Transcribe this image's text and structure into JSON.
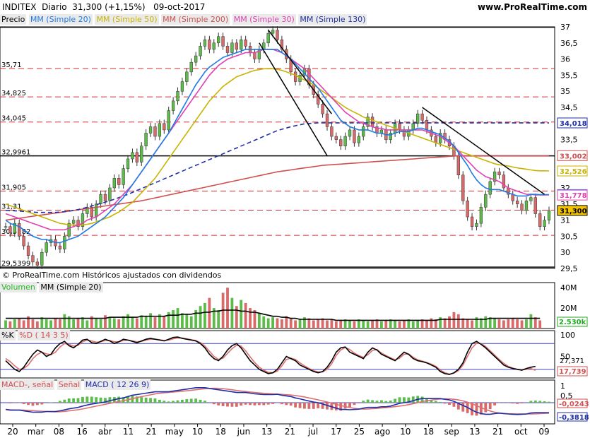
{
  "header": {
    "ticker": "INDITEX",
    "period": "Diario",
    "last": "31,300 (+1,15%)",
    "date": "09-oct-2017",
    "site": "www.ProRealTime.com"
  },
  "legend": [
    {
      "label": "Precio",
      "color": "#000000"
    },
    {
      "label": "MM (Simple 20)",
      "color": "#1e7be6"
    },
    {
      "label": "MM (Simple 50)",
      "color": "#c8b400"
    },
    {
      "label": "MM (Simple 200)",
      "color": "#d05050"
    },
    {
      "label": "MM (Simple 30)",
      "color": "#e040b0"
    },
    {
      "label": "MM (Simple 130)",
      "color": "#1f2fa8"
    }
  ],
  "copyright": "© ProRealTime.com Históricos ajustados con dividendos",
  "volume_label": {
    "vol": "Volumen",
    "mm": "MM (Simple 20)"
  },
  "stoch_label": {
    "k": "%K",
    "d": "%D ( 14 3 5)"
  },
  "macd_label": {
    "macd": "MACD-, señal",
    "senal": "Señal",
    "params": "MACD ( 12 26 9)"
  },
  "price_axis_ticks": [
    "37",
    "36,5",
    "36",
    "35,5",
    "35",
    "34,5",
    "34",
    "33,5",
    "33",
    "32,5",
    "32",
    "31,5",
    "31",
    "30,5",
    "30",
    "29,5"
  ],
  "left_levels": [
    "35,71",
    "34,825",
    "34,045",
    "32,9961",
    "31,905",
    "31,31",
    "30,5282",
    "29,5399"
  ],
  "right_badges": [
    {
      "text": "34,018",
      "color": "#1f2fa8",
      "bg": "#ffffff"
    },
    {
      "text": "33,002",
      "color": "#d05050",
      "bg": "#ffffff"
    },
    {
      "text": "32,526",
      "color": "#c8b400",
      "bg": "#ffffff"
    },
    {
      "text": "31,794",
      "color": "#1e7be6",
      "bg": "#ffffff"
    },
    {
      "text": "31,778",
      "color": "#e040b0",
      "bg": "#ffffff"
    },
    {
      "text": "31,300",
      "color": "#000000",
      "bg": "#f5c400"
    }
  ],
  "volume_axis": [
    "40M",
    "20M",
    "2.530k"
  ],
  "stoch_axis": [
    "100",
    "50",
    "27,371",
    "17,739"
  ],
  "macd_axis": [
    "1",
    "0,5",
    "-0,0243",
    "-0,3818"
  ],
  "x_labels": [
    "20",
    "mar",
    "08",
    "16",
    "abr",
    "11",
    "21",
    "may",
    "10",
    "18",
    "jun",
    "13",
    "21",
    "jul",
    "17",
    "25",
    "ago",
    "10",
    "18",
    "sep",
    "13",
    "21",
    "oct",
    "09"
  ],
  "chart_data": {
    "type": "candlestick",
    "title": "INDITEX Diario",
    "ylim": [
      29.5,
      37
    ],
    "levels_solid": [
      36.99,
      32.9961,
      29.5399
    ],
    "levels_dashed": [
      35.71,
      34.825,
      34.045,
      31.905,
      31.31,
      30.5282
    ],
    "close_series": [
      30.8,
      30.6,
      30.9,
      30.5,
      30.2,
      29.9,
      29.7,
      29.6,
      30.0,
      30.3,
      30.4,
      30.2,
      30.1,
      30.5,
      30.9,
      31.0,
      30.8,
      31.2,
      31.4,
      31.1,
      31.5,
      31.8,
      31.6,
      32.0,
      32.3,
      32.1,
      32.6,
      32.9,
      33.1,
      32.8,
      33.3,
      33.7,
      33.9,
      33.6,
      34.0,
      33.8,
      34.4,
      34.7,
      35.0,
      35.3,
      35.6,
      35.9,
      36.1,
      36.4,
      36.6,
      36.3,
      36.5,
      36.7,
      36.4,
      36.2,
      36.5,
      36.3,
      36.6,
      36.4,
      36.2,
      36.0,
      36.3,
      36.5,
      36.8,
      36.9,
      36.6,
      36.3,
      36.0,
      35.6,
      35.3,
      35.5,
      35.7,
      35.2,
      34.9,
      34.6,
      34.3,
      33.9,
      33.6,
      33.5,
      33.3,
      33.6,
      33.8,
      33.4,
      33.6,
      33.9,
      34.2,
      33.9,
      33.7,
      33.8,
      33.5,
      33.7,
      34.0,
      33.8,
      33.6,
      33.8,
      34.0,
      34.3,
      34.1,
      33.8,
      33.6,
      33.4,
      33.7,
      33.5,
      33.3,
      33.0,
      32.4,
      31.6,
      31.1,
      30.8,
      30.9,
      31.4,
      31.8,
      32.2,
      32.5,
      32.4,
      32.0,
      31.8,
      31.6,
      31.5,
      31.3,
      31.6,
      31.7,
      31.2,
      30.8,
      31.0,
      31.3
    ],
    "ma20": [
      31.0,
      30.9,
      30.85,
      30.8,
      30.7,
      30.6,
      30.5,
      30.45,
      30.4,
      30.4,
      30.35,
      30.3,
      30.3,
      30.35,
      30.4,
      30.45,
      30.5,
      30.6,
      30.7,
      30.8,
      30.9,
      31.0,
      31.1,
      31.25,
      31.4,
      31.55,
      31.7,
      31.9,
      32.1,
      32.3,
      32.5,
      32.7,
      32.9,
      33.1,
      33.3,
      33.5,
      33.7,
      33.95,
      34.2,
      34.45,
      34.7,
      34.95,
      35.2,
      35.4,
      35.6,
      35.75,
      35.85,
      35.95,
      36.05,
      36.1,
      36.15,
      36.2,
      36.25,
      36.3,
      36.3,
      36.3,
      36.3,
      36.3,
      36.3,
      36.3,
      36.3,
      36.2,
      36.1,
      36.0,
      35.85,
      35.7,
      35.55,
      35.4,
      35.25,
      35.1,
      34.9,
      34.7,
      34.5,
      34.3,
      34.1,
      34.0,
      33.9,
      33.85,
      33.8,
      33.8,
      33.8,
      33.75,
      33.7,
      33.7,
      33.65,
      33.65,
      33.7,
      33.75,
      33.75,
      33.75,
      33.8,
      33.85,
      33.85,
      33.8,
      33.75,
      33.7,
      33.65,
      33.55,
      33.45,
      33.3,
      33.1,
      32.9,
      32.7,
      32.45,
      32.25,
      32.1,
      32.0,
      31.95,
      31.95,
      31.95,
      31.9,
      31.85,
      31.8,
      31.75,
      31.75,
      31.75,
      31.8,
      31.8,
      31.79,
      31.79,
      31.79
    ],
    "ma30": [
      31.2,
      31.15,
      31.1,
      31.05,
      31.0,
      30.95,
      30.9,
      30.85,
      30.8,
      30.75,
      30.7,
      30.7,
      30.7,
      30.7,
      30.75,
      30.8,
      30.85,
      30.9,
      31.0,
      31.05,
      31.1,
      31.2,
      31.3,
      31.4,
      31.5,
      31.65,
      31.8,
      31.95,
      32.1,
      32.3,
      32.5,
      32.7,
      32.9,
      33.1,
      33.3,
      33.5,
      33.7,
      33.9,
      34.1,
      34.3,
      34.5,
      34.7,
      34.9,
      35.1,
      35.3,
      35.5,
      35.65,
      35.8,
      35.9,
      36.0,
      36.05,
      36.1,
      36.15,
      36.2,
      36.2,
      36.2,
      36.25,
      36.3,
      36.3,
      36.3,
      36.25,
      36.2,
      36.1,
      36.0,
      35.9,
      35.8,
      35.7,
      35.55,
      35.4,
      35.25,
      35.1,
      34.95,
      34.8,
      34.65,
      34.5,
      34.35,
      34.25,
      34.15,
      34.05,
      34.0,
      33.95,
      33.9,
      33.85,
      33.85,
      33.8,
      33.8,
      33.8,
      33.8,
      33.8,
      33.8,
      33.8,
      33.8,
      33.8,
      33.75,
      33.7,
      33.65,
      33.6,
      33.5,
      33.4,
      33.3,
      33.15,
      33.0,
      32.85,
      32.7,
      32.55,
      32.45,
      32.35,
      32.3,
      32.25,
      32.2,
      32.1,
      32.0,
      31.95,
      31.9,
      31.85,
      31.8,
      31.8,
      31.78,
      31.78,
      31.78,
      31.78
    ],
    "ma50": [
      31.5,
      31.45,
      31.4,
      31.35,
      31.3,
      31.25,
      31.2,
      31.15,
      31.1,
      31.05,
      31.0,
      30.95,
      30.9,
      30.88,
      30.85,
      30.85,
      30.85,
      30.85,
      30.87,
      30.9,
      30.95,
      31.0,
      31.05,
      31.1,
      31.18,
      31.25,
      31.35,
      31.45,
      31.55,
      31.7,
      31.85,
      32.0,
      32.15,
      32.3,
      32.5,
      32.7,
      32.9,
      33.1,
      33.3,
      33.5,
      33.7,
      33.9,
      34.1,
      34.3,
      34.5,
      34.7,
      34.85,
      35.0,
      35.15,
      35.25,
      35.35,
      35.45,
      35.5,
      35.55,
      35.6,
      35.65,
      35.67,
      35.7,
      35.7,
      35.7,
      35.68,
      35.65,
      35.6,
      35.55,
      35.5,
      35.42,
      35.35,
      35.28,
      35.2,
      35.1,
      35.0,
      34.9,
      34.8,
      34.7,
      34.6,
      34.5,
      34.42,
      34.35,
      34.28,
      34.2,
      34.15,
      34.1,
      34.05,
      34.0,
      33.95,
      33.9,
      33.85,
      33.8,
      33.75,
      33.7,
      33.65,
      33.6,
      33.55,
      33.5,
      33.45,
      33.4,
      33.35,
      33.3,
      33.25,
      33.2,
      33.15,
      33.1,
      33.05,
      33.0,
      32.95,
      32.9,
      32.85,
      32.8,
      32.75,
      32.72,
      32.7,
      32.68,
      32.65,
      32.62,
      32.6,
      32.58,
      32.56,
      32.54,
      32.53,
      32.53,
      32.526
    ],
    "ma130": [
      31.3,
      31.3,
      31.29,
      31.28,
      31.27,
      31.26,
      31.25,
      31.24,
      31.24,
      31.24,
      31.24,
      31.24,
      31.25,
      31.26,
      31.28,
      31.3,
      31.33,
      31.36,
      31.4,
      31.44,
      31.48,
      31.52,
      31.56,
      31.6,
      31.65,
      31.7,
      31.75,
      31.8,
      31.86,
      31.92,
      31.98,
      32.04,
      32.1,
      32.16,
      32.22,
      32.28,
      32.34,
      32.4,
      32.46,
      32.52,
      32.58,
      32.64,
      32.7,
      32.76,
      32.82,
      32.88,
      32.94,
      33.0,
      33.06,
      33.12,
      33.18,
      33.24,
      33.3,
      33.36,
      33.42,
      33.48,
      33.54,
      33.6,
      33.66,
      33.72,
      33.78,
      33.82,
      33.86,
      33.9,
      33.93,
      33.96,
      33.99,
      34.0,
      34.01,
      34.02,
      34.02,
      34.02,
      34.02,
      34.02,
      34.02,
      34.02,
      34.02,
      34.02,
      34.02,
      34.02,
      34.02,
      34.02,
      34.02,
      34.02,
      34.02,
      34.02,
      34.02,
      34.02,
      34.02,
      34.02,
      34.02,
      34.02,
      34.02,
      34.02,
      34.02,
      34.02,
      34.02,
      34.02,
      34.02,
      34.02,
      34.02,
      34.02,
      34.02,
      34.02,
      34.02,
      34.02,
      34.02,
      34.02,
      34.02,
      34.02,
      34.02,
      34.02,
      34.02,
      34.02,
      34.02,
      34.02,
      34.02,
      34.02,
      34.02,
      34.02,
      34.018
    ],
    "ma200": [
      31.0,
      31.02,
      31.04,
      31.06,
      31.08,
      31.1,
      31.12,
      31.14,
      31.16,
      31.18,
      31.2,
      31.22,
      31.24,
      31.26,
      31.28,
      31.3,
      31.32,
      31.34,
      31.36,
      31.38,
      31.4,
      31.42,
      31.44,
      31.46,
      31.48,
      31.5,
      31.52,
      31.54,
      31.56,
      31.58,
      31.6,
      31.63,
      31.66,
      31.69,
      31.72,
      31.75,
      31.78,
      31.81,
      31.84,
      31.87,
      31.9,
      31.93,
      31.96,
      31.99,
      32.02,
      32.05,
      32.08,
      32.11,
      32.14,
      32.17,
      32.2,
      32.23,
      32.26,
      32.29,
      32.32,
      32.35,
      32.38,
      32.41,
      32.44,
      32.47,
      32.5,
      32.52,
      32.54,
      32.56,
      32.58,
      32.6,
      32.62,
      32.64,
      32.66,
      32.68,
      32.7,
      32.71,
      32.72,
      32.73,
      32.74,
      32.75,
      32.76,
      32.77,
      32.78,
      32.79,
      32.8,
      32.81,
      32.82,
      32.83,
      32.84,
      32.85,
      32.86,
      32.87,
      32.88,
      32.89,
      32.9,
      32.91,
      32.92,
      32.93,
      32.94,
      32.95,
      32.96,
      32.97,
      32.98,
      32.99,
      33.0,
      33.0,
      33.0,
      33.0,
      33.0,
      33.0,
      33.0,
      33.0,
      33.0,
      33.0,
      33.0,
      33.0,
      33.0,
      33.0,
      33.0,
      33.0,
      33.0,
      33.0,
      33.0,
      33.0,
      33.002
    ],
    "volume": [
      8,
      7,
      9,
      10,
      8,
      12,
      9,
      7,
      11,
      9,
      8,
      10,
      9,
      14,
      12,
      9,
      10,
      11,
      8,
      12,
      10,
      9,
      13,
      11,
      10,
      9,
      12,
      14,
      11,
      10,
      13,
      12,
      15,
      11,
      14,
      12,
      16,
      18,
      20,
      15,
      14,
      12,
      18,
      22,
      25,
      30,
      20,
      18,
      35,
      40,
      30,
      22,
      28,
      25,
      20,
      18,
      15,
      12,
      10,
      11,
      10,
      9,
      12,
      10,
      8,
      9,
      11,
      10,
      8,
      9,
      10,
      8,
      9,
      7,
      8,
      9,
      8,
      7,
      9,
      8,
      7,
      8,
      9,
      7,
      8,
      9,
      8,
      7,
      8,
      9,
      7,
      8,
      9,
      8,
      10,
      9,
      11,
      10,
      12,
      16,
      14,
      10,
      9,
      8,
      11,
      10,
      12,
      11,
      10,
      9,
      8,
      9,
      10,
      9,
      8,
      9,
      14,
      11,
      8
    ],
    "volume_ma20": [
      10,
      10,
      10,
      10,
      10,
      10,
      10,
      10,
      10,
      10,
      10,
      10,
      10,
      10,
      10,
      10,
      10,
      10,
      10,
      10,
      10,
      10,
      10,
      11,
      11,
      11,
      11,
      11,
      11,
      11,
      12,
      12,
      12,
      12,
      12,
      12,
      13,
      13,
      13,
      14,
      14,
      14,
      15,
      15,
      16,
      16,
      17,
      17,
      18,
      18,
      18,
      18,
      17,
      17,
      16,
      16,
      15,
      14,
      13,
      12,
      12,
      11,
      11,
      10,
      10,
      9,
      9,
      9,
      9,
      9,
      9,
      9,
      9,
      8,
      8,
      8,
      8,
      8,
      8,
      8,
      8,
      8,
      8,
      8,
      8,
      8,
      8,
      8,
      8,
      8,
      8,
      8,
      8,
      8,
      8,
      8,
      9,
      9,
      9,
      9,
      9,
      9,
      9,
      9,
      9,
      9,
      9,
      10,
      10,
      10,
      10,
      10,
      10,
      10,
      10,
      10,
      10,
      10,
      10
    ],
    "stoch_k": [
      40,
      30,
      20,
      15,
      25,
      40,
      55,
      65,
      60,
      50,
      55,
      70,
      80,
      85,
      75,
      70,
      78,
      88,
      90,
      82,
      80,
      85,
      90,
      86,
      80,
      84,
      90,
      88,
      85,
      82,
      86,
      90,
      92,
      90,
      88,
      86,
      90,
      94,
      95,
      92,
      90,
      88,
      86,
      80,
      70,
      55,
      45,
      40,
      50,
      65,
      75,
      80,
      70,
      55,
      40,
      30,
      20,
      15,
      10,
      12,
      20,
      35,
      50,
      45,
      40,
      30,
      25,
      20,
      15,
      12,
      15,
      25,
      40,
      60,
      70,
      72,
      60,
      55,
      50,
      45,
      60,
      70,
      65,
      55,
      50,
      45,
      40,
      50,
      60,
      55,
      45,
      40,
      38,
      35,
      30,
      25,
      15,
      10,
      8,
      12,
      20,
      35,
      60,
      80,
      85,
      78,
      70,
      60,
      50,
      40,
      30,
      25,
      22,
      20,
      18,
      22,
      25,
      27
    ],
    "stoch_d": [
      45,
      38,
      28,
      20,
      22,
      30,
      45,
      55,
      60,
      56,
      54,
      60,
      72,
      80,
      78,
      74,
      76,
      84,
      88,
      86,
      83,
      84,
      87,
      87,
      84,
      84,
      87,
      88,
      86,
      84,
      85,
      88,
      90,
      90,
      89,
      87,
      88,
      91,
      93,
      93,
      91,
      89,
      87,
      82,
      74,
      62,
      50,
      43,
      46,
      57,
      68,
      76,
      74,
      63,
      49,
      36,
      25,
      18,
      13,
      12,
      16,
      28,
      43,
      46,
      43,
      35,
      28,
      22,
      17,
      14,
      14,
      20,
      33,
      52,
      65,
      71,
      66,
      58,
      52,
      48,
      54,
      64,
      66,
      58,
      52,
      47,
      42,
      46,
      55,
      56,
      48,
      42,
      39,
      36,
      32,
      27,
      18,
      12,
      9,
      11,
      17,
      30,
      50,
      70,
      81,
      80,
      73,
      63,
      53,
      43,
      34,
      27,
      23,
      20,
      19,
      20,
      22,
      17.7
    ]
  }
}
